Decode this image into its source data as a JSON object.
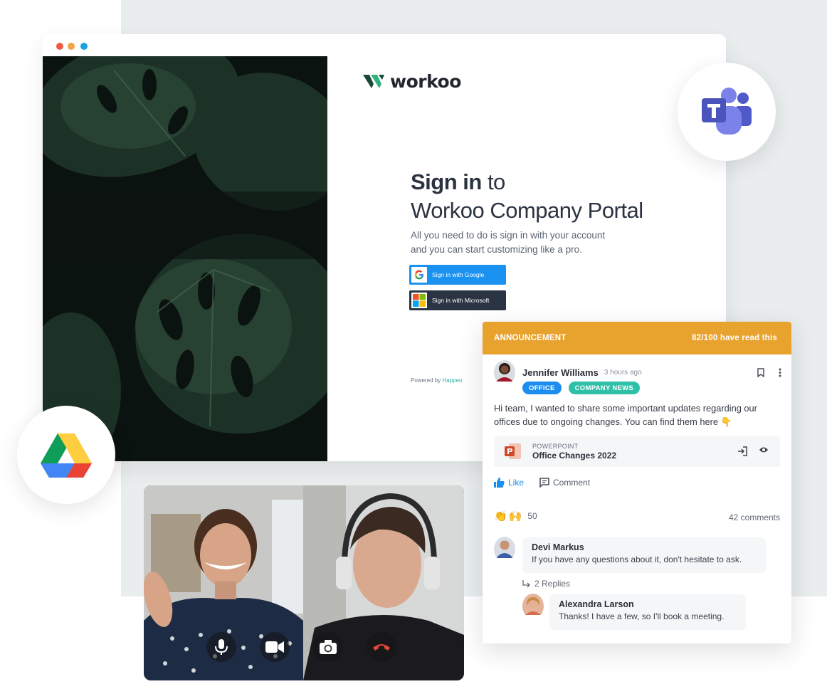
{
  "browser": {
    "brand": "workoo",
    "heading_bold": "Sign in",
    "heading_rest": " to",
    "heading_line2": "Workoo Company Portal",
    "intro_line1": "All you need to do is sign in with your account",
    "intro_line2": "and you can start customizing like a pro.",
    "google_button": "Sign in with Google",
    "microsoft_button": "Sign in with Microsoft",
    "powered_prefix": "Powered by ",
    "powered_link": "Happeo"
  },
  "announcement": {
    "header_label": "ANNOUNCEMENT",
    "read_status": "82/100 have read this",
    "author": "Jennifer Williams",
    "time": "3 hours ago",
    "tags": [
      "OFFICE",
      "COMPANY NEWS"
    ],
    "body": "Hi team, I wanted to share some important updates regarding our offices due to ongoing changes. You can find them here 👇",
    "attachment": {
      "type": "POWERPOINT",
      "name": "Office Changes 2022"
    },
    "like_label": "Like",
    "comment_label": "Comment",
    "reaction_count": "50",
    "comments_count": "42 comments",
    "comments": [
      {
        "name": "Devi Markus",
        "text": "If you have any questions about it, don't hesitate to ask."
      },
      {
        "name": "Alexandra Larson",
        "text": "Thanks! I have a few, so I'll book a meeting."
      }
    ],
    "replies_label": "2 Replies"
  },
  "colors": {
    "announcement": "#e8a22e",
    "google_button": "#1a92f2",
    "microsoft_button": "#2b3442",
    "tag_office": "#1b8ef0",
    "tag_news": "#2fc0a8",
    "teams": "#5059c9",
    "hangup": "#e0453a"
  },
  "icons": [
    "microsoft-teams-icon",
    "google-drive-icon",
    "microphone-icon",
    "video-camera-icon",
    "switch-camera-icon",
    "hang-up-icon",
    "bookmark-icon",
    "more-options-icon",
    "open-icon",
    "eye-icon",
    "thumbs-up-icon",
    "comment-icon",
    "clapping-hands-icon",
    "raised-hands-icon",
    "reply-arrow-icon"
  ]
}
